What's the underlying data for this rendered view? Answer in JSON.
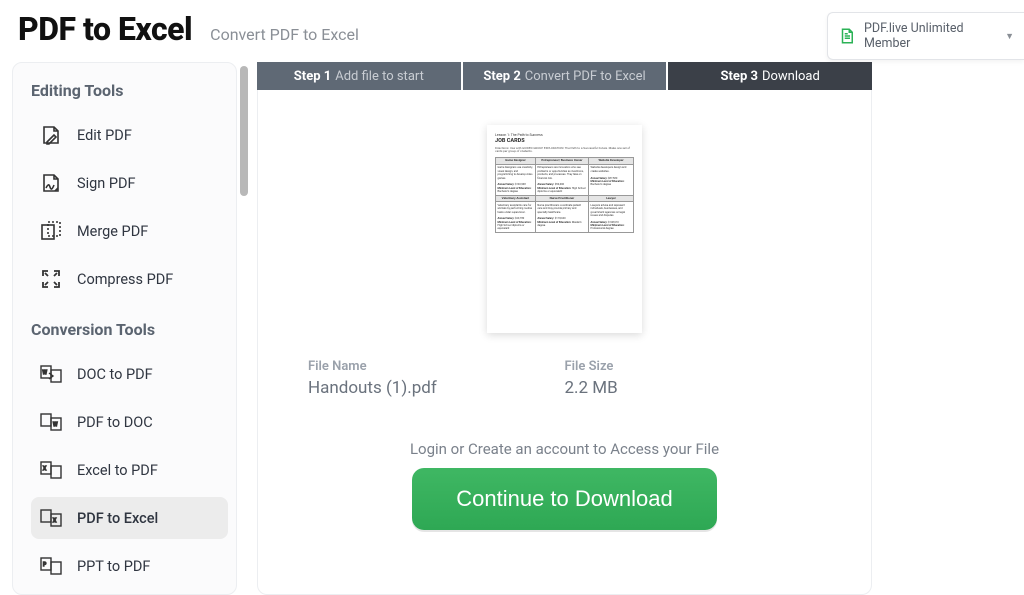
{
  "header": {
    "title": "PDF to Excel",
    "subtitle": "Convert PDF to Excel"
  },
  "member": {
    "label": "PDF.live Unlimited Member"
  },
  "sidebar": {
    "editing_heading": "Editing Tools",
    "conversion_heading": "Conversion Tools",
    "editing": [
      {
        "label": "Edit PDF"
      },
      {
        "label": "Sign PDF"
      },
      {
        "label": "Merge PDF"
      },
      {
        "label": "Compress PDF"
      }
    ],
    "conversion": [
      {
        "label": "DOC to PDF"
      },
      {
        "label": "PDF to DOC"
      },
      {
        "label": "Excel to PDF"
      },
      {
        "label": "PDF to Excel"
      },
      {
        "label": "PPT to PDF"
      }
    ]
  },
  "steps": {
    "s1b": "Step 1",
    "s1": "Add file to start",
    "s2b": "Step 2",
    "s2": "Convert PDF to Excel",
    "s3b": "Step 3",
    "s3": "Download"
  },
  "file": {
    "name_label": "File Name",
    "name_value": "Handouts (1).pdf",
    "size_label": "File Size",
    "size_value": "2.2 MB"
  },
  "login_text": "Login or Create an account to Access your File",
  "cta_label": "Continue to Download",
  "preview": {
    "lesson": "Lesson 1: The Path to Success",
    "job": "JOB CARDS",
    "directions": "Directions: Use with GUIDED GROUP EXPLORATION: The Path to a Successful Future. Make one set of cards per group of students.",
    "r1h": [
      "Game Designer",
      "Entrepreneur/ Business Owner",
      "Website Developer"
    ],
    "r2h": [
      "Veterinary Assistant",
      "Nurse Practitioner",
      "Lawyer"
    ]
  }
}
